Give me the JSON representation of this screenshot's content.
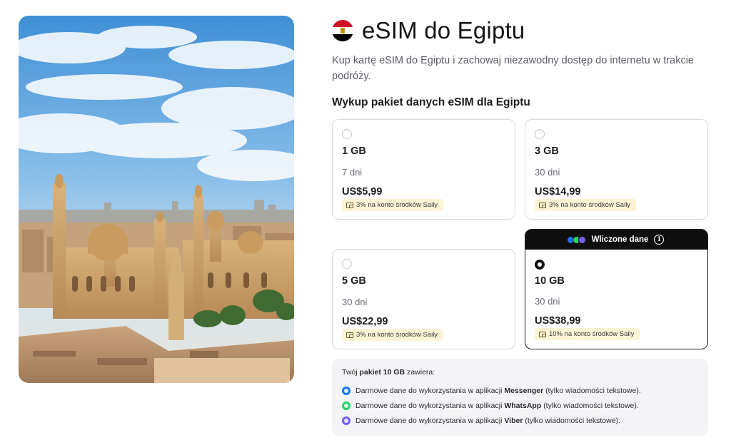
{
  "header": {
    "title": "eSIM do Egiptu",
    "subtitle": "Kup kartę eSIM do Egiptu i zachowaj niezawodny dostęp do internetu w trakcie podróży.",
    "flag_colors": [
      "#ce1126",
      "#ffffff",
      "#000000"
    ]
  },
  "plans_section": {
    "heading": "Wykup pakiet danych eSIM dla Egiptu",
    "plans": [
      {
        "data": "1 GB",
        "duration": "7 dni",
        "price": "US$5,99",
        "cashback": "3% na konto środków Saily",
        "selected": false
      },
      {
        "data": "3 GB",
        "duration": "30 dni",
        "price": "US$14,99",
        "cashback": "3% na konto środków Saily",
        "selected": false
      },
      {
        "data": "5 GB",
        "duration": "30 dni",
        "price": "US$22,99",
        "cashback": "3% na konto środków Saily",
        "selected": false
      },
      {
        "data": "10 GB",
        "duration": "30 dni",
        "price": "US$38,99",
        "cashback": "10% na konto środków Saily",
        "selected": true,
        "badge": "Wliczone dane",
        "badge_icons": [
          "messenger-icon",
          "whatsapp-icon",
          "viber-icon"
        ]
      }
    ]
  },
  "summary": {
    "prefix": "Twój",
    "package": "pakiet 10 GB",
    "suffix": "zawiera:",
    "items": [
      {
        "icon": "messenger-icon",
        "color": "#1877f2",
        "before": "Darmowe dane do wykorzystania w aplikacji",
        "app": "Messenger",
        "after": "(tylko wiadomości tekstowe)."
      },
      {
        "icon": "whatsapp-icon",
        "color": "#25d366",
        "before": "Darmowe dane do wykorzystania w aplikacji",
        "app": "WhatsApp",
        "after": "(tylko wiadomości tekstowe)."
      },
      {
        "icon": "viber-icon",
        "color": "#7360f2",
        "before": "Darmowe dane do wykorzystania w aplikacji",
        "app": "Viber",
        "after": "(tylko wiadomości tekstowe)."
      }
    ]
  },
  "colors": {
    "cashback_bg": "#fdf4d5",
    "selected_border": "#1d1d1f",
    "badge_bg": "#0f0f10"
  }
}
